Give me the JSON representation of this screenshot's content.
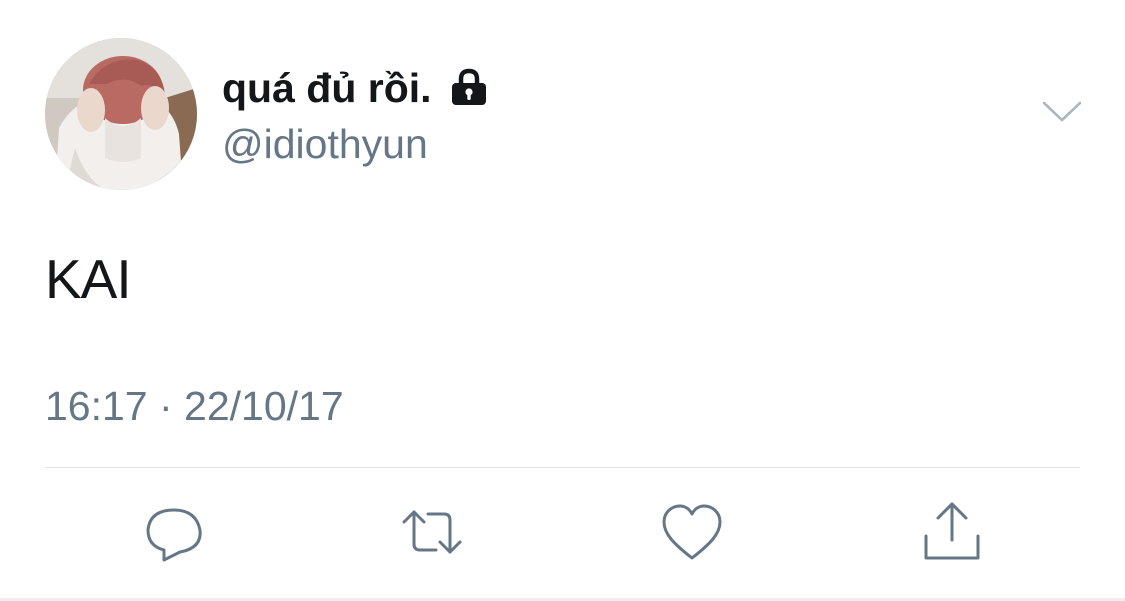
{
  "tweet": {
    "author": {
      "display_name": "quá đủ rồi.",
      "handle": "@idiothyun",
      "avatar_icon": "avatar-photo",
      "protected_icon": "lock-icon"
    },
    "menu_icon": "chevron-down-icon",
    "text": "KAI",
    "timestamp": "16:17 · 22/10/17",
    "actions": [
      {
        "name": "reply",
        "icon": "reply-icon"
      },
      {
        "name": "retweet",
        "icon": "retweet-icon"
      },
      {
        "name": "like",
        "icon": "heart-icon"
      },
      {
        "name": "share",
        "icon": "share-icon"
      }
    ]
  },
  "colors": {
    "text_primary": "#14171a",
    "text_secondary": "#657786",
    "icon": "#657786",
    "divider": "#dfe3e6",
    "background": "#ffffff"
  }
}
